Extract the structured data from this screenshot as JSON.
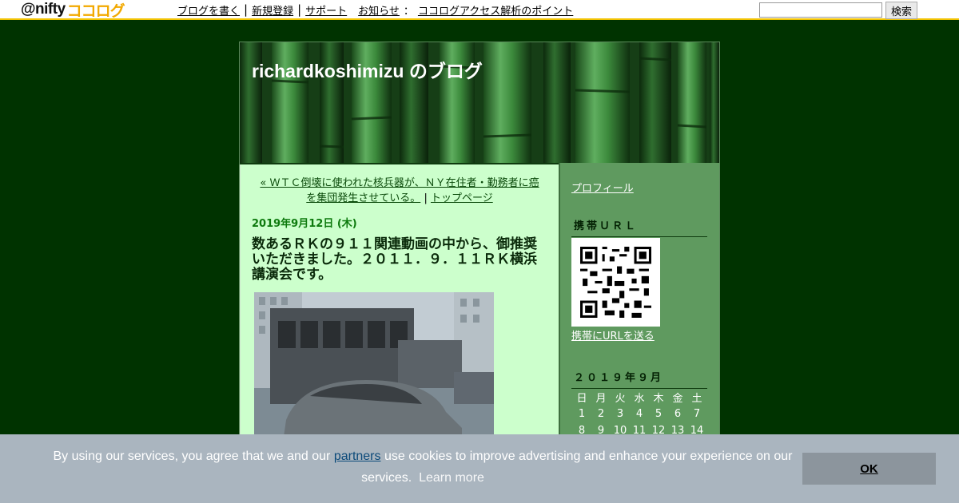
{
  "topbar": {
    "logo_prefix": "@nifty",
    "logo_brand": "ココログ",
    "links": [
      "ブログを書く",
      "新規登録",
      "サポート",
      "お知らせ",
      "ココログアクセス解析のポイント"
    ],
    "colon": "：",
    "search_button": "検索",
    "search_value": ""
  },
  "blog": {
    "title": "richardkoshimizu のブログ"
  },
  "post": {
    "prev_link": "« ＷＴＣ倒壊に使われた核兵器が、ＮＹ在住者・勤務者に癌を集団発生させている。",
    "nav_separator": "|",
    "top_link": "トップページ",
    "date": "2019年9月12日 (木)",
    "title": "数あるＲＫの９１１関連動画の中から、御推奨いただきました。２０１１．９．１１ＲＫ横浜講演会です。"
  },
  "sidebar": {
    "profile": "プロフィール",
    "mobile_heading": "携帯ＵＲＬ",
    "send_url": "携帯にURLを送る",
    "calendar_heading": "２０１９年９月",
    "weekdays": [
      "日",
      "月",
      "火",
      "水",
      "木",
      "金",
      "土"
    ],
    "weeks": [
      [
        "1",
        "2",
        "3",
        "4",
        "5",
        "6",
        "7"
      ],
      [
        "8",
        "9",
        "10",
        "11",
        "12",
        "13",
        "14"
      ]
    ]
  },
  "cookie": {
    "text_before": "By using our services, you agree that we and our ",
    "partners": "partners",
    "text_after": " use cookies to improve advertising and enhance your experience on our services.",
    "learn_more": "Learn more",
    "ok": "OK"
  },
  "colors": {
    "page_bg": "#003300",
    "main_bg": "#ccffcc",
    "sidebar_bg": "#5f9a5f",
    "date_green": "#0d7a0d",
    "logo_accent": "#f2a900"
  }
}
